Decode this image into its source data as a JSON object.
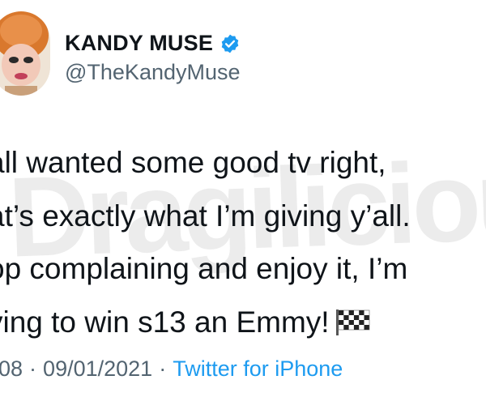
{
  "author": {
    "display_name": "KANDY MUSE",
    "handle": "@TheKandyMuse",
    "verified": true,
    "verified_color": "#1d9bf0"
  },
  "tweet": {
    "lines": [
      "all wanted some good tv right,",
      "at’s exactly what I’m giving y’all.",
      "op complaining and enjoy it, I’m",
      "ying to win s13 an Emmy!"
    ],
    "emoji": "chequered-flag-icon"
  },
  "watermark": "Dragilicious",
  "meta": {
    "time": "08",
    "separator": "·",
    "date": "09/01/2021",
    "source": "Twitter for iPhone",
    "link_color": "#1d9bf0",
    "muted_color": "#536471"
  }
}
